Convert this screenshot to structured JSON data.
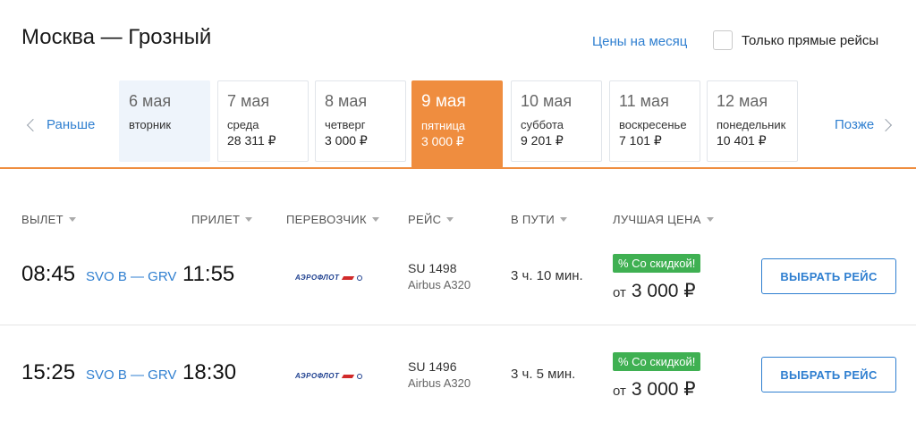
{
  "header": {
    "route": "Москва — Грозный",
    "month_prices_link": "Цены на месяц",
    "direct_only_label": "Только прямые рейсы"
  },
  "date_nav": {
    "prev_label": "Раньше",
    "next_label": "Позже",
    "days": [
      {
        "date": "6 мая",
        "weekday": "вторник",
        "price": ""
      },
      {
        "date": "7 мая",
        "weekday": "среда",
        "price": "28 311 ₽"
      },
      {
        "date": "8 мая",
        "weekday": "четверг",
        "price": "3 000 ₽"
      },
      {
        "date": "9 мая",
        "weekday": "пятница",
        "price": "3 000 ₽"
      },
      {
        "date": "10 мая",
        "weekday": "суббота",
        "price": "9 201 ₽"
      },
      {
        "date": "11 мая",
        "weekday": "воскресенье",
        "price": "7 101 ₽"
      },
      {
        "date": "12 мая",
        "weekday": "понедельник",
        "price": "10 401 ₽"
      }
    ]
  },
  "table_headers": {
    "departure": "ВЫЛЕТ",
    "arrival": "ПРИЛЕТ",
    "carrier": "ПЕРЕВОЗЧИК",
    "flight": "РЕЙС",
    "duration": "В ПУТИ",
    "best_price": "ЛУЧШАЯ ЦЕНА"
  },
  "flights": [
    {
      "dep_time": "08:45",
      "route": "SVO B — GRV",
      "arr_time": "11:55",
      "carrier": "АЭРОФЛОТ",
      "flight_no": "SU 1498",
      "aircraft": "Airbus A320",
      "duration": "3 ч. 10 мин.",
      "badge": "% Со скидкой!",
      "price_prefix": "от",
      "price": "3 000 ₽",
      "button": "ВЫБРАТЬ РЕЙС"
    },
    {
      "dep_time": "15:25",
      "route": "SVO B — GRV",
      "arr_time": "18:30",
      "carrier": "АЭРОФЛОТ",
      "flight_no": "SU 1496",
      "aircraft": "Airbus A320",
      "duration": "3 ч. 5 мин.",
      "badge": "% Со скидкой!",
      "price_prefix": "от",
      "price": "3 000 ₽",
      "button": "ВЫБРАТЬ РЕЙС"
    }
  ],
  "colors": {
    "accent": "#ef8d3f",
    "link": "#2f7fd0",
    "discount": "#3fb052"
  }
}
